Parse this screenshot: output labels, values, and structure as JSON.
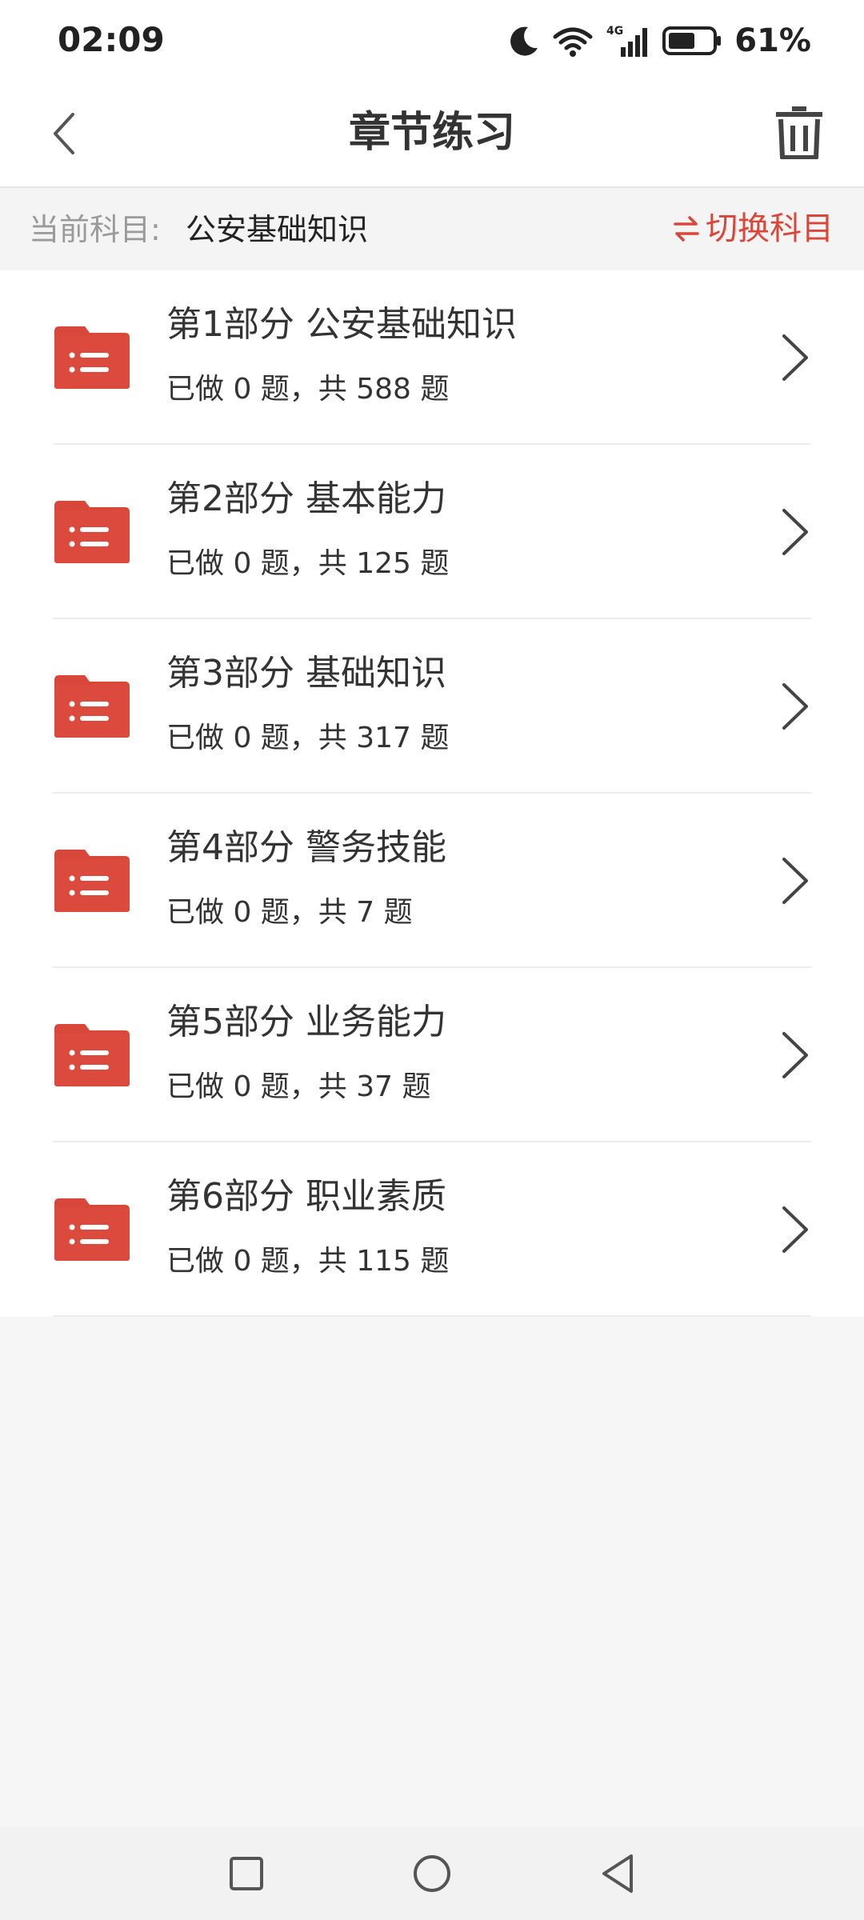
{
  "status_bar": {
    "time": "02:09",
    "network": "4G",
    "battery_percent": "61%",
    "battery_level": 0.61,
    "icons": [
      "moon-icon",
      "wifi-icon",
      "signal-icon",
      "battery-icon"
    ]
  },
  "header": {
    "title": "章节练习",
    "back_icon": "back-chevron-icon",
    "trash_icon": "trash-icon"
  },
  "subject_bar": {
    "label": "当前科目:",
    "value": "公安基础知识",
    "switch_label": "切换科目",
    "switch_icon": "swap-arrows-icon"
  },
  "chapters": [
    {
      "title": "第1部分 公安基础知识",
      "progress": "已做 0 题，共 588 题"
    },
    {
      "title": "第2部分 基本能力",
      "progress": "已做 0 题，共 125 题"
    },
    {
      "title": "第3部分 基础知识",
      "progress": "已做 0 题，共 317 题"
    },
    {
      "title": "第4部分 警务技能",
      "progress": "已做 0 题，共 7 题"
    },
    {
      "title": "第5部分 业务能力",
      "progress": "已做 0 题，共 37 题"
    },
    {
      "title": "第6部分 职业素质",
      "progress": "已做 0 题，共 115 题"
    }
  ],
  "colors": {
    "accent": "#d9463a",
    "folder": "#d9463a",
    "background": "#f6f6f6",
    "text": "#333333",
    "muted": "#9a9a9a"
  },
  "system_nav": {
    "icons": [
      "recents-square-icon",
      "home-circle-icon",
      "back-triangle-icon"
    ]
  }
}
